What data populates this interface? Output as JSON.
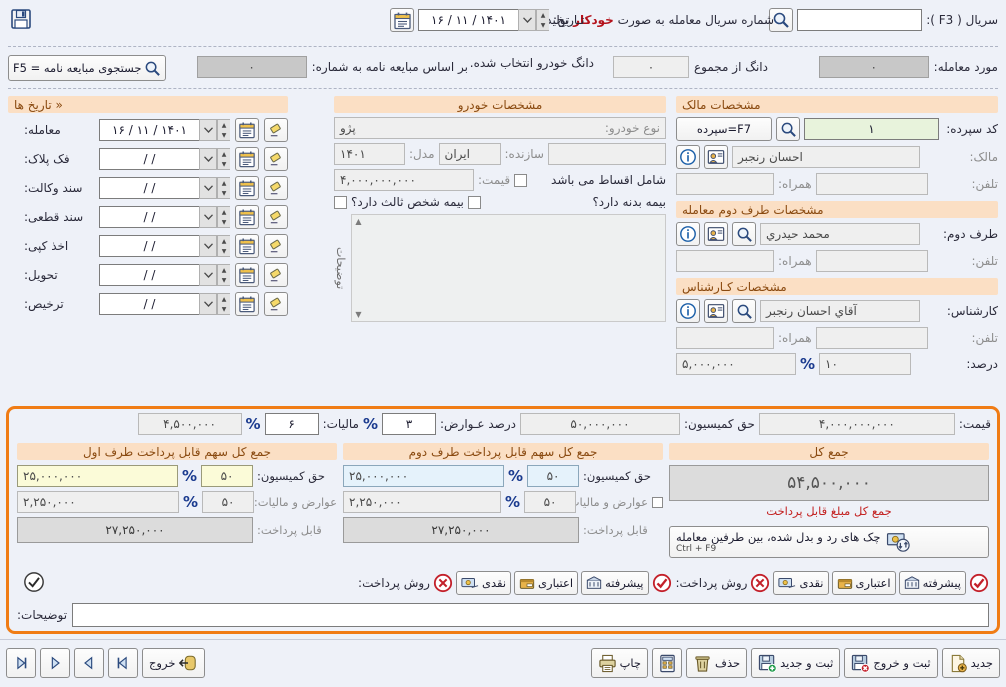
{
  "colors": {
    "accent_orange": "#f07c15",
    "panel_head_bg": "#fbdfc4",
    "panel_head_fg": "#8a4a10",
    "red_note": "#b4121b",
    "total_caption": "#c32020"
  },
  "header": {
    "serial_label": "سریال ( F3 ):",
    "serial_value": "",
    "serial_note_pre": "شماره سریال معامله به صورت ",
    "serial_note_bold": "خودکار",
    "serial_note_post": " تولید خواهد شد.",
    "date_label": "تـاریخ:",
    "date_value": "۱۴۰۱ / ۱۱ / ۱۶",
    "save_icon": "floppy-disk-icon",
    "search_icon": "magnifier-icon"
  },
  "row2": {
    "subject_label": "مورد معامله:",
    "subject_value": "۰",
    "dang_of_total_label": "دانگ از مجموع",
    "dang_of_total_value": "۰",
    "dang_vehicle_label": "دانگ خودرو انتخاب شده.",
    "by_number_label": "بر اساس مبایعه نامه به شماره:",
    "by_number_value": "۰",
    "search_btn_label": "جستجوی مبایعه نامه = F5"
  },
  "dates": {
    "title": "« تاریخ ها",
    "items": [
      {
        "label": "معامله:",
        "value": "۱۴۰۱ / ۱۱ / ۱۶"
      },
      {
        "label": "فک پلاک:",
        "value": "/        /"
      },
      {
        "label": "سند وکالت:",
        "value": "/        /"
      },
      {
        "label": "سند قطعی:",
        "value": "/        /"
      },
      {
        "label": "اخذ کپی:",
        "value": "/        /"
      },
      {
        "label": "تحویل:",
        "value": "/        /"
      },
      {
        "label": "ترخیص:",
        "value": "/        /"
      }
    ],
    "calendar_icon": "calendar-icon",
    "eraser_icon": "eraser-icon"
  },
  "vehicle": {
    "title": "مشخصات خودرو",
    "type_label": "نوع خودرو:",
    "type_value": "پژو",
    "model_label": "مدل:",
    "model_value": "۱۴۰۱",
    "maker_label": "سازنده:",
    "maker_value": "ایران",
    "maker_extra_value": "",
    "price_label": "قیمت:",
    "price_value": "۴,۰۰۰,۰۰۰,۰۰۰",
    "installment_label": "شامل اقساط می باشد",
    "installment_checked": false,
    "third_party_label": "بیمه شخص ثالث دارد؟",
    "third_party_checked": false,
    "body_insurance_label": "بیمه بدنه دارد؟",
    "body_insurance_checked": false,
    "notes_label": "توضیحات",
    "notes_value": ""
  },
  "owner": {
    "title": "مشخصات مالک",
    "deposit_code_label": "کد سپرده:",
    "deposit_code_value": "۱",
    "deposit_btn_label": "F7=سپرده",
    "owner_label": "مالک:",
    "owner_value": "احسان رنجبر",
    "phone_label": "تلفن:",
    "phone_value": "",
    "mobile_label": "همراه:",
    "mobile_value": ""
  },
  "second_party": {
    "title": "مشخصات طرف دوم معامله",
    "name_label": "طرف دوم:",
    "name_value": "محمد حيدري",
    "phone_label": "تلفن:",
    "phone_value": "",
    "mobile_label": "همراه:",
    "mobile_value": ""
  },
  "expert": {
    "title": "مشخصات کـارشناس",
    "name_label": "کارشناس:",
    "name_value": "آقاي احسان رنجبر",
    "phone_label": "تلفن:",
    "phone_value": "",
    "mobile_label": "همراه:",
    "mobile_value": "",
    "percent_label": "درصد:",
    "percent_value": "۱۰",
    "percent_symbol": "%",
    "amount_value": "۵,۰۰۰,۰۰۰"
  },
  "icons": {
    "info_icon": "info-circle-icon",
    "person_card_icon": "person-card-icon",
    "magnifier_icon": "magnifier-icon"
  },
  "finance": {
    "top_row": {
      "price_label": "قیمت:",
      "price_value": "۴,۰۰۰,۰۰۰,۰۰۰",
      "commission_label": "حق کمیسیون:",
      "commission_value": "۵۰,۰۰۰,۰۰۰",
      "duty_percent_label": "درصد عـوارض:",
      "duty_percent_value": "۳",
      "tax_label": "مالیات:",
      "tax_percent_symbol": "%",
      "tax_percent_value": "۶",
      "tax_symbol": "%",
      "tax_amount_value": "۴,۵۰۰,۰۰۰"
    },
    "heads": {
      "party1": "جمع کل سهم قابل پرداخت طرف اول",
      "party2": "جمع کل سهم قابل پرداخت طرف دوم",
      "total": "جمع کل"
    },
    "party1": {
      "commission_label": "حق کمیسیون:",
      "commission_percent": "۵۰",
      "commission_symbol": "%",
      "commission_amount": "۲۵,۰۰۰,۰۰۰",
      "duty_tax_label": "عوارض و مالیات:",
      "duty_tax_percent": "۵۰",
      "duty_tax_symbol": "%",
      "duty_tax_amount": "۲,۲۵۰,۰۰۰",
      "payable_label": "قابل پرداخت:",
      "payable_amount": "۲۷,۲۵۰,۰۰۰",
      "pay_method_label": "روش پرداخت:",
      "methods": [
        {
          "label": "نقدی",
          "icon": "cash-icon"
        },
        {
          "label": "اعتباری",
          "icon": "credit-icon"
        },
        {
          "label": "پیشرفته",
          "icon": "advanced-icon"
        }
      ],
      "clear_icon": "red-x-icon",
      "money_icon": "banknote-exchange-icon",
      "confirm_icon": "red-check-icon"
    },
    "party2": {
      "commission_label": "حق کمیسیون:",
      "commission_percent": "۵۰",
      "commission_symbol": "%",
      "commission_amount": "۲۵,۰۰۰,۰۰۰",
      "duty_tax_label": "عوارض و مالیات:",
      "duty_tax_percent": "۵۰",
      "duty_tax_symbol": "%",
      "duty_tax_amount": "۲,۲۵۰,۰۰۰",
      "payable_label": "قابل پرداخت:",
      "payable_amount": "۲۷,۲۵۰,۰۰۰",
      "pay_method_label": "روش پرداخت:",
      "methods": [
        {
          "label": "نقدی",
          "icon": "cash-icon"
        },
        {
          "label": "اعتباری",
          "icon": "credit-icon"
        },
        {
          "label": "پیشرفته",
          "icon": "advanced-icon"
        }
      ],
      "clear_icon": "red-x-icon",
      "money_icon": "banknote-exchange-icon",
      "confirm_icon": "red-check-icon"
    },
    "total": {
      "amount": "۵۴,۵۰۰,۰۰۰",
      "caption": "جمع کل مبلغ قابل پرداخت",
      "cheque_btn_label": "چک های رد و بدل شده، بین طرفین معامله",
      "cheque_btn_shortcut": "Ctrl + F9",
      "cheque_icon": "cheque-exchange-icon",
      "ok_icon": "check-circle-icon"
    },
    "description_label": "توضیحات:",
    "description_value": ""
  },
  "toolbar": {
    "right_buttons": [
      {
        "label": "جدید",
        "icon": "new-doc-icon"
      },
      {
        "label": "ثبت و خروج",
        "icon": "save-exit-icon"
      },
      {
        "label": "ثبت و جدید",
        "icon": "save-new-icon"
      },
      {
        "label": "حذف",
        "icon": "trash-icon"
      },
      {
        "label": "",
        "icon": "calculator-icon"
      },
      {
        "label": "چاپ",
        "icon": "printer-icon"
      }
    ],
    "nav_buttons": [
      {
        "icon": "nav-last-icon"
      },
      {
        "icon": "nav-next-icon"
      },
      {
        "icon": "nav-prev-icon"
      },
      {
        "icon": "nav-first-icon"
      }
    ],
    "exit_label": "خروج",
    "exit_icon": "exit-door-icon"
  }
}
